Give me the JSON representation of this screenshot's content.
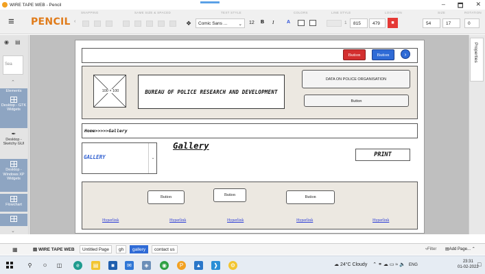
{
  "window": {
    "title": "WIRE TAPE WEB - Pencil",
    "minimize": "–",
    "maximize": "🗖",
    "close": "✕"
  },
  "toolbar": {
    "menu_icon": "≡",
    "app_name": "PENCIL",
    "back": "‹",
    "section_labels": [
      "SNAPPING",
      "SAME SIZE & SPACED",
      "TEXT STYLE",
      "COLORS",
      "LINE STYLE",
      "LOCATION",
      "SIZE",
      "ROTATION"
    ],
    "font_family": "Comic Sans ...",
    "font_size": "12",
    "bold": "B",
    "italic": "I",
    "text_color": "A",
    "stroke_width": "1",
    "location_x": "815",
    "location_y": "479",
    "size_w": "54",
    "size_h": "17",
    "rotation": "0"
  },
  "left_palette": {
    "search_placeholder": "Sea",
    "items": [
      {
        "label": "Elements"
      },
      {
        "label": "Desktop - GTK Widgets"
      },
      {
        "label": "Desktop - Sketchy GUI"
      },
      {
        "label": "Desktop - Windows XP Widgets"
      },
      {
        "label": "Flowchart"
      }
    ]
  },
  "right_panel": {
    "tab_label": "Properties"
  },
  "wireframe": {
    "header_buttons": {
      "red": "Button",
      "blue": "Button",
      "next": "›"
    },
    "image_placeholder": "100 × 100",
    "site_title": "BUREAU OF POLICE RESEARCH AND DEVELOPMENT",
    "data_button": "DATA ON POLICE ORGANISATION",
    "banner_button": "Button",
    "breadcrumb": "Home>>>>>Gallery",
    "gallery_heading": "Gallery",
    "select_value": "GALLERY",
    "print_button": "PRINT",
    "footer_buttons": [
      "Button",
      "Button",
      "Button"
    ],
    "footer_links": [
      "Hyperlink",
      "Hyperlink",
      "Hyperlink",
      "Hyperlink",
      "Hyperlink"
    ]
  },
  "pagebar": {
    "project": "WIRE TAPE WEB",
    "tabs": [
      {
        "label": "Untitled Page",
        "active": false
      },
      {
        "label": "gh",
        "active": false
      },
      {
        "label": "gallery",
        "active": true
      },
      {
        "label": "contact us",
        "active": false
      }
    ],
    "filter": "Filter",
    "add_page": "Add Page..."
  },
  "taskbar": {
    "weather": "24°C Cloudy",
    "lang": "ENG",
    "time": "23:31",
    "date": "01-02-2022"
  },
  "colors": {
    "accent": "#e07b1a",
    "red_button": "#d32f2f",
    "blue_button": "#2f6bd6",
    "link": "#2a3bd6"
  }
}
